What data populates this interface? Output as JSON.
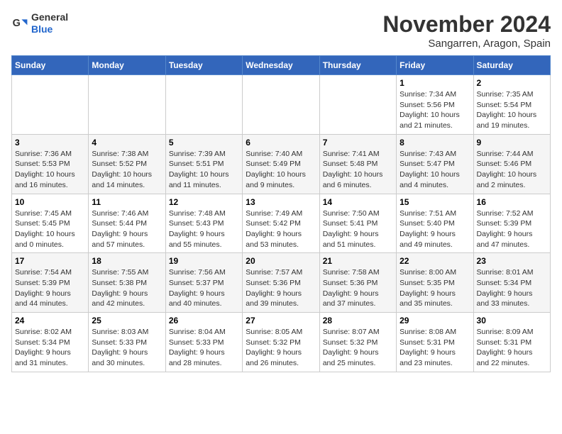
{
  "logo": {
    "general": "General",
    "blue": "Blue"
  },
  "title": "November 2024",
  "location": "Sangarren, Aragon, Spain",
  "weekdays": [
    "Sunday",
    "Monday",
    "Tuesday",
    "Wednesday",
    "Thursday",
    "Friday",
    "Saturday"
  ],
  "weeks": [
    [
      {
        "day": "",
        "info": ""
      },
      {
        "day": "",
        "info": ""
      },
      {
        "day": "",
        "info": ""
      },
      {
        "day": "",
        "info": ""
      },
      {
        "day": "",
        "info": ""
      },
      {
        "day": "1",
        "info": "Sunrise: 7:34 AM\nSunset: 5:56 PM\nDaylight: 10 hours\nand 21 minutes."
      },
      {
        "day": "2",
        "info": "Sunrise: 7:35 AM\nSunset: 5:54 PM\nDaylight: 10 hours\nand 19 minutes."
      }
    ],
    [
      {
        "day": "3",
        "info": "Sunrise: 7:36 AM\nSunset: 5:53 PM\nDaylight: 10 hours\nand 16 minutes."
      },
      {
        "day": "4",
        "info": "Sunrise: 7:38 AM\nSunset: 5:52 PM\nDaylight: 10 hours\nand 14 minutes."
      },
      {
        "day": "5",
        "info": "Sunrise: 7:39 AM\nSunset: 5:51 PM\nDaylight: 10 hours\nand 11 minutes."
      },
      {
        "day": "6",
        "info": "Sunrise: 7:40 AM\nSunset: 5:49 PM\nDaylight: 10 hours\nand 9 minutes."
      },
      {
        "day": "7",
        "info": "Sunrise: 7:41 AM\nSunset: 5:48 PM\nDaylight: 10 hours\nand 6 minutes."
      },
      {
        "day": "8",
        "info": "Sunrise: 7:43 AM\nSunset: 5:47 PM\nDaylight: 10 hours\nand 4 minutes."
      },
      {
        "day": "9",
        "info": "Sunrise: 7:44 AM\nSunset: 5:46 PM\nDaylight: 10 hours\nand 2 minutes."
      }
    ],
    [
      {
        "day": "10",
        "info": "Sunrise: 7:45 AM\nSunset: 5:45 PM\nDaylight: 10 hours\nand 0 minutes."
      },
      {
        "day": "11",
        "info": "Sunrise: 7:46 AM\nSunset: 5:44 PM\nDaylight: 9 hours\nand 57 minutes."
      },
      {
        "day": "12",
        "info": "Sunrise: 7:48 AM\nSunset: 5:43 PM\nDaylight: 9 hours\nand 55 minutes."
      },
      {
        "day": "13",
        "info": "Sunrise: 7:49 AM\nSunset: 5:42 PM\nDaylight: 9 hours\nand 53 minutes."
      },
      {
        "day": "14",
        "info": "Sunrise: 7:50 AM\nSunset: 5:41 PM\nDaylight: 9 hours\nand 51 minutes."
      },
      {
        "day": "15",
        "info": "Sunrise: 7:51 AM\nSunset: 5:40 PM\nDaylight: 9 hours\nand 49 minutes."
      },
      {
        "day": "16",
        "info": "Sunrise: 7:52 AM\nSunset: 5:39 PM\nDaylight: 9 hours\nand 47 minutes."
      }
    ],
    [
      {
        "day": "17",
        "info": "Sunrise: 7:54 AM\nSunset: 5:39 PM\nDaylight: 9 hours\nand 44 minutes."
      },
      {
        "day": "18",
        "info": "Sunrise: 7:55 AM\nSunset: 5:38 PM\nDaylight: 9 hours\nand 42 minutes."
      },
      {
        "day": "19",
        "info": "Sunrise: 7:56 AM\nSunset: 5:37 PM\nDaylight: 9 hours\nand 40 minutes."
      },
      {
        "day": "20",
        "info": "Sunrise: 7:57 AM\nSunset: 5:36 PM\nDaylight: 9 hours\nand 39 minutes."
      },
      {
        "day": "21",
        "info": "Sunrise: 7:58 AM\nSunset: 5:36 PM\nDaylight: 9 hours\nand 37 minutes."
      },
      {
        "day": "22",
        "info": "Sunrise: 8:00 AM\nSunset: 5:35 PM\nDaylight: 9 hours\nand 35 minutes."
      },
      {
        "day": "23",
        "info": "Sunrise: 8:01 AM\nSunset: 5:34 PM\nDaylight: 9 hours\nand 33 minutes."
      }
    ],
    [
      {
        "day": "24",
        "info": "Sunrise: 8:02 AM\nSunset: 5:34 PM\nDaylight: 9 hours\nand 31 minutes."
      },
      {
        "day": "25",
        "info": "Sunrise: 8:03 AM\nSunset: 5:33 PM\nDaylight: 9 hours\nand 30 minutes."
      },
      {
        "day": "26",
        "info": "Sunrise: 8:04 AM\nSunset: 5:33 PM\nDaylight: 9 hours\nand 28 minutes."
      },
      {
        "day": "27",
        "info": "Sunrise: 8:05 AM\nSunset: 5:32 PM\nDaylight: 9 hours\nand 26 minutes."
      },
      {
        "day": "28",
        "info": "Sunrise: 8:07 AM\nSunset: 5:32 PM\nDaylight: 9 hours\nand 25 minutes."
      },
      {
        "day": "29",
        "info": "Sunrise: 8:08 AM\nSunset: 5:31 PM\nDaylight: 9 hours\nand 23 minutes."
      },
      {
        "day": "30",
        "info": "Sunrise: 8:09 AM\nSunset: 5:31 PM\nDaylight: 9 hours\nand 22 minutes."
      }
    ]
  ]
}
